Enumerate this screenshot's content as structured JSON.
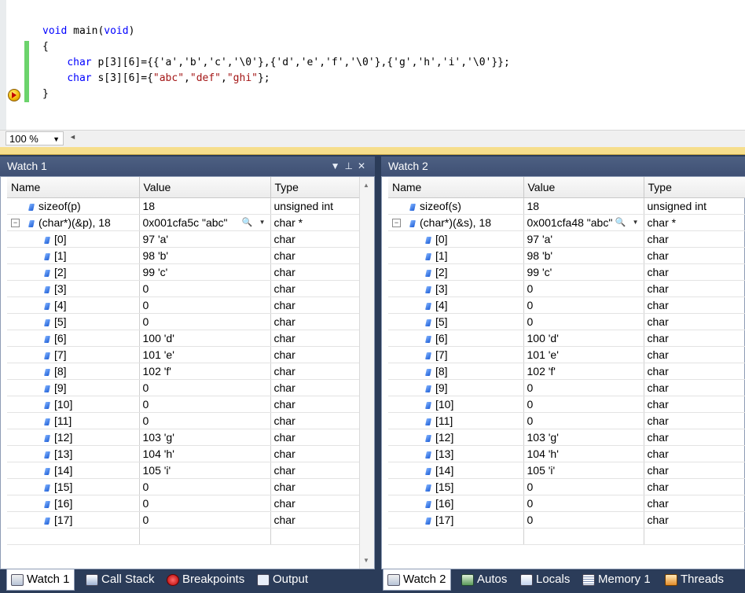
{
  "editor": {
    "code_lines": [
      "void main(void)",
      "{",
      "    char p[3][6]={{'a','b','c','\\0'},{'d','e','f','\\0'},{'g','h','i','\\0'}};",
      "    char s[3][6]={\"abc\",\"def\",\"ghi\"};",
      "}"
    ],
    "zoom": "100 %"
  },
  "watch1": {
    "title": "Watch 1",
    "columns": [
      "Name",
      "Value",
      "Type"
    ],
    "rows": [
      {
        "name": "sizeof(p)",
        "value": "18",
        "type": "unsigned int",
        "level": 0,
        "expander": false
      },
      {
        "name": "(char*)(&p), 18",
        "value": "0x001cfa5c \"abc\"",
        "type": "char *",
        "level": 0,
        "expander": true
      },
      {
        "name": "[0]",
        "value": "97 'a'",
        "type": "char",
        "level": 1
      },
      {
        "name": "[1]",
        "value": "98 'b'",
        "type": "char",
        "level": 1
      },
      {
        "name": "[2]",
        "value": "99 'c'",
        "type": "char",
        "level": 1
      },
      {
        "name": "[3]",
        "value": "0",
        "type": "char",
        "level": 1
      },
      {
        "name": "[4]",
        "value": "0",
        "type": "char",
        "level": 1
      },
      {
        "name": "[5]",
        "value": "0",
        "type": "char",
        "level": 1
      },
      {
        "name": "[6]",
        "value": "100 'd'",
        "type": "char",
        "level": 1
      },
      {
        "name": "[7]",
        "value": "101 'e'",
        "type": "char",
        "level": 1
      },
      {
        "name": "[8]",
        "value": "102 'f'",
        "type": "char",
        "level": 1
      },
      {
        "name": "[9]",
        "value": "0",
        "type": "char",
        "level": 1
      },
      {
        "name": "[10]",
        "value": "0",
        "type": "char",
        "level": 1
      },
      {
        "name": "[11]",
        "value": "0",
        "type": "char",
        "level": 1
      },
      {
        "name": "[12]",
        "value": "103 'g'",
        "type": "char",
        "level": 1
      },
      {
        "name": "[13]",
        "value": "104 'h'",
        "type": "char",
        "level": 1
      },
      {
        "name": "[14]",
        "value": "105 'i'",
        "type": "char",
        "level": 1
      },
      {
        "name": "[15]",
        "value": "0",
        "type": "char",
        "level": 1
      },
      {
        "name": "[16]",
        "value": "0",
        "type": "char",
        "level": 1
      },
      {
        "name": "[17]",
        "value": "0",
        "type": "char",
        "level": 1
      }
    ]
  },
  "watch2": {
    "title": "Watch 2",
    "columns": [
      "Name",
      "Value",
      "Type"
    ],
    "rows": [
      {
        "name": "sizeof(s)",
        "value": "18",
        "type": "unsigned int",
        "level": 0,
        "expander": false
      },
      {
        "name": "(char*)(&s), 18",
        "value": "0x001cfa48 \"abc\"",
        "type": "char *",
        "level": 0,
        "expander": true
      },
      {
        "name": "[0]",
        "value": "97 'a'",
        "type": "char",
        "level": 1
      },
      {
        "name": "[1]",
        "value": "98 'b'",
        "type": "char",
        "level": 1
      },
      {
        "name": "[2]",
        "value": "99 'c'",
        "type": "char",
        "level": 1
      },
      {
        "name": "[3]",
        "value": "0",
        "type": "char",
        "level": 1
      },
      {
        "name": "[4]",
        "value": "0",
        "type": "char",
        "level": 1
      },
      {
        "name": "[5]",
        "value": "0",
        "type": "char",
        "level": 1
      },
      {
        "name": "[6]",
        "value": "100 'd'",
        "type": "char",
        "level": 1
      },
      {
        "name": "[7]",
        "value": "101 'e'",
        "type": "char",
        "level": 1
      },
      {
        "name": "[8]",
        "value": "102 'f'",
        "type": "char",
        "level": 1
      },
      {
        "name": "[9]",
        "value": "0",
        "type": "char",
        "level": 1
      },
      {
        "name": "[10]",
        "value": "0",
        "type": "char",
        "level": 1
      },
      {
        "name": "[11]",
        "value": "0",
        "type": "char",
        "level": 1
      },
      {
        "name": "[12]",
        "value": "103 'g'",
        "type": "char",
        "level": 1
      },
      {
        "name": "[13]",
        "value": "104 'h'",
        "type": "char",
        "level": 1
      },
      {
        "name": "[14]",
        "value": "105 'i'",
        "type": "char",
        "level": 1
      },
      {
        "name": "[15]",
        "value": "0",
        "type": "char",
        "level": 1
      },
      {
        "name": "[16]",
        "value": "0",
        "type": "char",
        "level": 1
      },
      {
        "name": "[17]",
        "value": "0",
        "type": "char",
        "level": 1
      }
    ]
  },
  "tabs_left": [
    {
      "label": "Watch 1",
      "icon": "watch-icon",
      "active": true
    },
    {
      "label": "Call Stack",
      "icon": "call-stack-icon",
      "active": false
    },
    {
      "label": "Breakpoints",
      "icon": "breakpoints-icon",
      "active": false
    },
    {
      "label": "Output",
      "icon": "output-icon",
      "active": false
    }
  ],
  "tabs_right": [
    {
      "label": "Watch 2",
      "icon": "watch-icon",
      "active": true
    },
    {
      "label": "Autos",
      "icon": "autos-icon",
      "active": false
    },
    {
      "label": "Locals",
      "icon": "locals-icon",
      "active": false
    },
    {
      "label": "Memory 1",
      "icon": "memory-icon",
      "active": false
    },
    {
      "label": "Threads",
      "icon": "threads-icon",
      "active": false
    }
  ],
  "colors": {
    "panel_header": "#3f5074",
    "background": "#2b3c59",
    "change_bar": "#6cd36c",
    "splitter": "#f6de8c"
  }
}
